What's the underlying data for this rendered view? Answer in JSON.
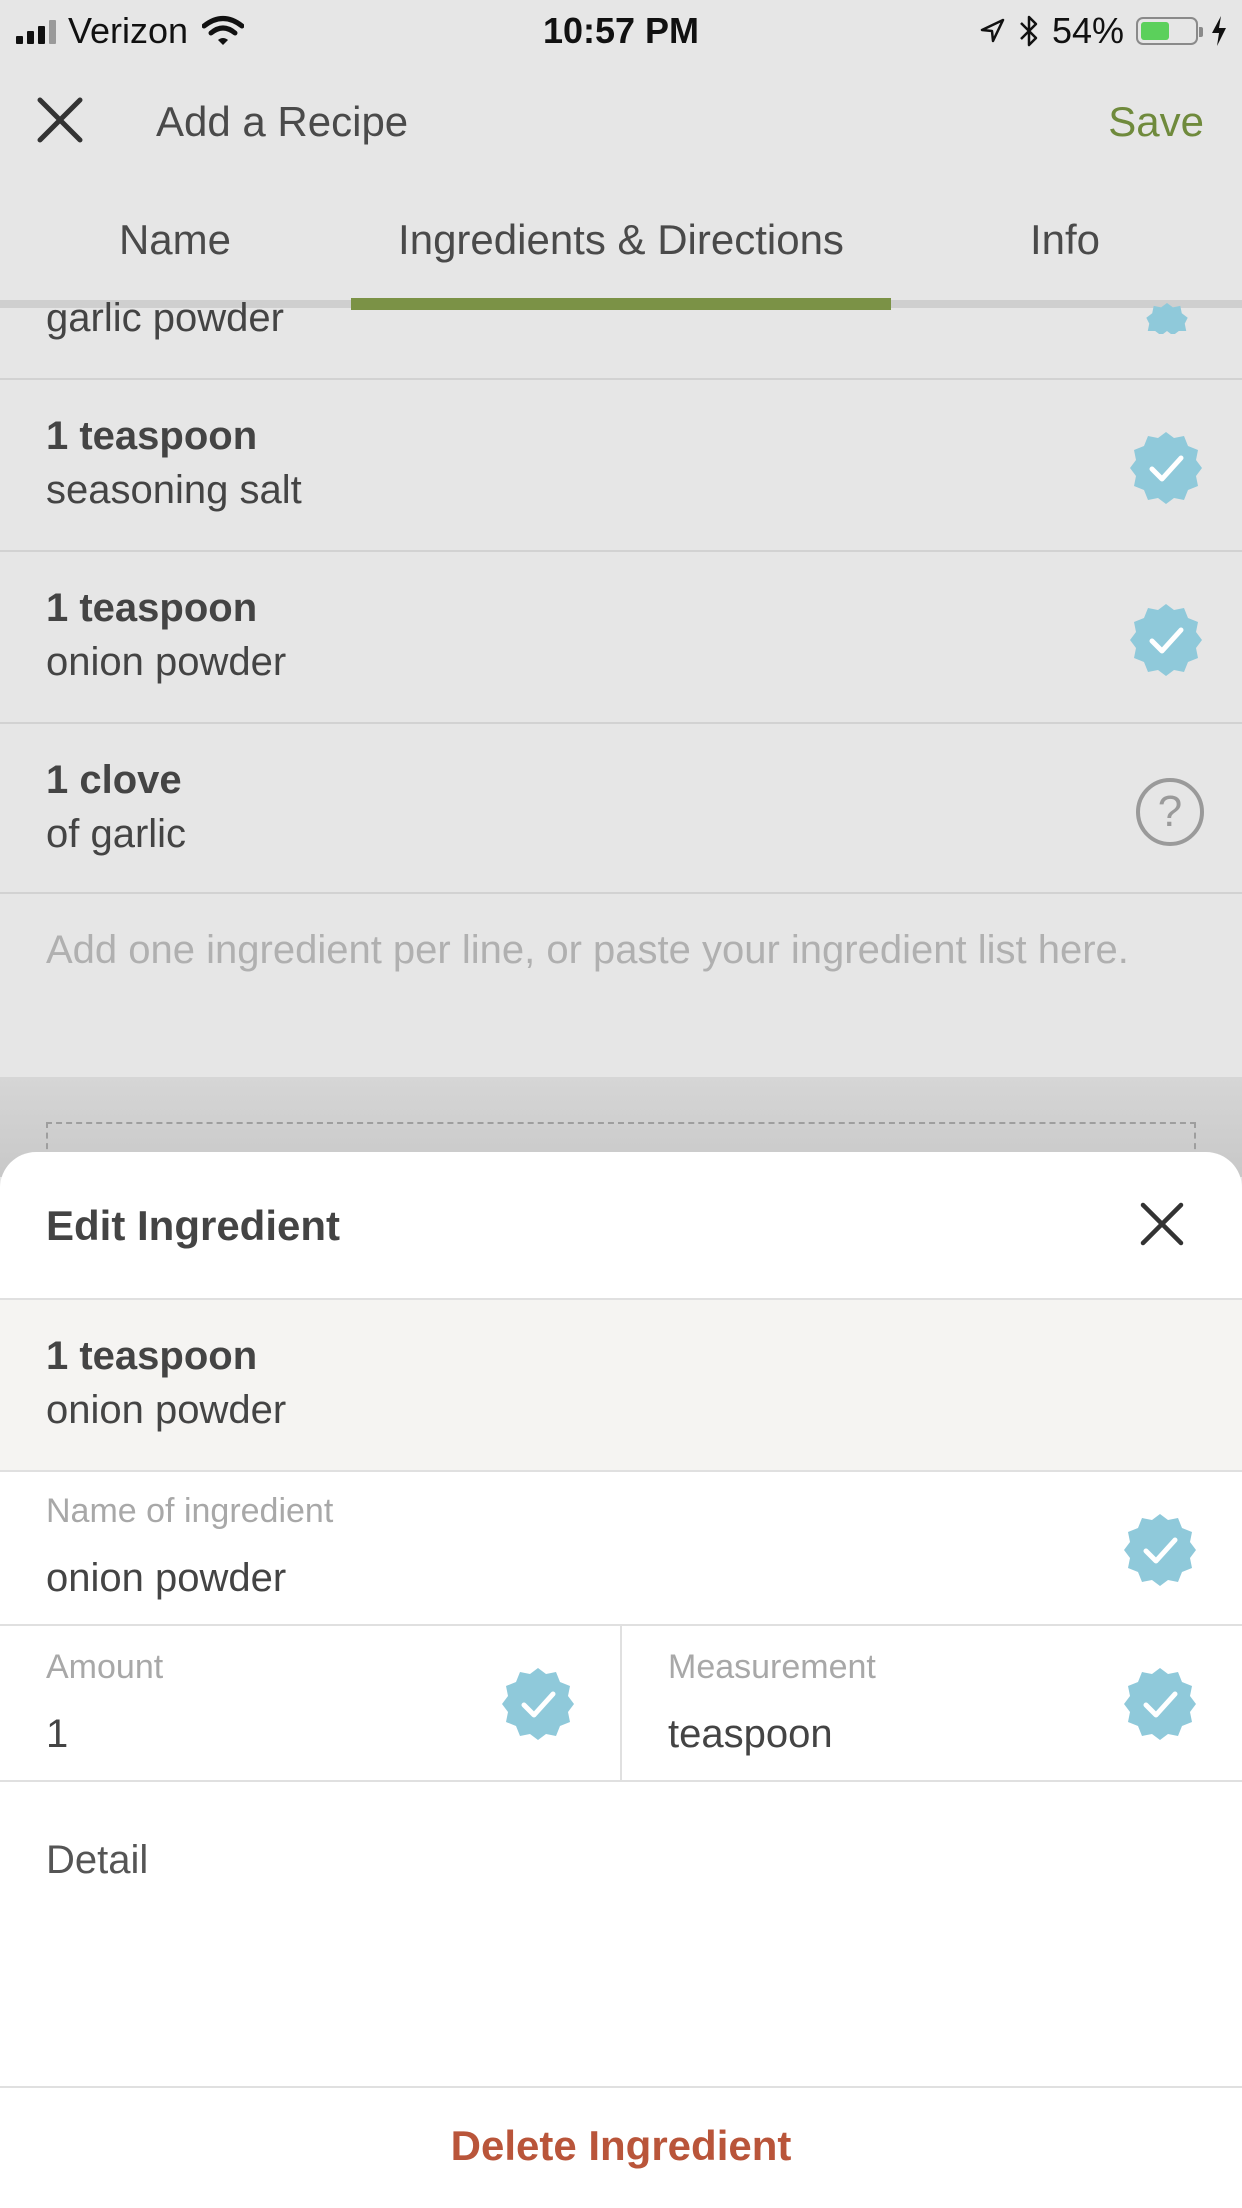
{
  "status_bar": {
    "carrier": "Verizon",
    "time": "10:57 PM",
    "battery_percent_label": "54%",
    "battery_level": 0.54
  },
  "nav": {
    "title": "Add a Recipe",
    "save_label": "Save"
  },
  "tabs": [
    {
      "label": "Name"
    },
    {
      "label": "Ingredients & Directions",
      "active": true
    },
    {
      "label": "Info"
    }
  ],
  "ingredients": {
    "partial_item": "garlic powder",
    "items": [
      {
        "amount": "1 teaspoon",
        "name": "seasoning salt",
        "status": "verified"
      },
      {
        "amount": "1 teaspoon",
        "name": "onion powder",
        "status": "verified"
      },
      {
        "amount": "1 clove",
        "name": "of garlic",
        "status": "unknown"
      }
    ],
    "placeholder": "Add one ingredient per line, or paste your ingredient list here."
  },
  "edit_sheet": {
    "title": "Edit Ingredient",
    "summary": {
      "amount": "1 teaspoon",
      "name": "onion powder"
    },
    "name_field": {
      "label": "Name of ingredient",
      "value": "onion powder"
    },
    "amount_field": {
      "label": "Amount",
      "value": "1"
    },
    "measurement_field": {
      "label": "Measurement",
      "value": "teaspoon"
    },
    "detail_label": "Detail",
    "delete_label": "Delete Ingredient"
  },
  "colors": {
    "accent_green": "#6f8a3c",
    "badge_blue": "#8fc9da",
    "delete_red": "#b9553a"
  }
}
